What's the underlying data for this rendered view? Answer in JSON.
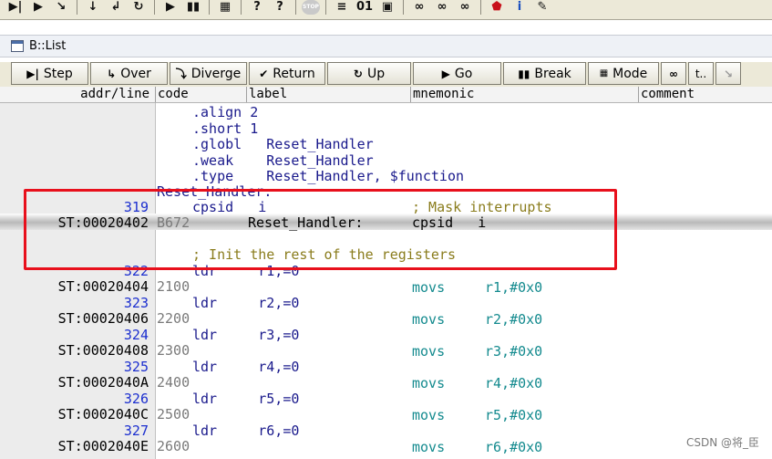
{
  "window": {
    "title": "B::List"
  },
  "toolbar_buttons": [
    {
      "label": "▶|",
      "name": "step-into-icon"
    },
    {
      "label": "▶",
      "name": "step-over-icon"
    },
    {
      "label": "↘",
      "name": "diverge-icon"
    },
    {
      "label": "↓",
      "name": "down-arrow-icon"
    },
    {
      "label": "↲",
      "name": "return-icon"
    },
    {
      "label": "↻",
      "name": "up-icon"
    },
    {
      "label": "▶",
      "name": "go-icon"
    },
    {
      "label": "▮▮",
      "name": "break-icon"
    },
    {
      "label": "▦",
      "name": "mode-icon"
    },
    {
      "label": "?",
      "name": "help-icon"
    },
    {
      "label": "?",
      "name": "context-help-icon"
    },
    {
      "label": "STOP",
      "name": "stop-icon"
    },
    {
      "label": "≡",
      "name": "list-icon"
    },
    {
      "label": "01",
      "name": "memory-icon"
    },
    {
      "label": "▣",
      "name": "chip-icon"
    },
    {
      "label": "∞",
      "name": "watch-icon"
    },
    {
      "label": "∞",
      "name": "watch2-icon"
    },
    {
      "label": "∞",
      "name": "watch3-icon"
    },
    {
      "label": "⬟",
      "name": "shield-icon"
    },
    {
      "label": "i",
      "name": "info-icon"
    },
    {
      "label": "✎",
      "name": "tools-icon"
    }
  ],
  "list_toolbar": {
    "step": "Step",
    "over": "Over",
    "diverge": "Diverge",
    "return": "Return",
    "up": "Up",
    "go": "Go",
    "break": "Break",
    "mode": "Mode",
    "extra1": "",
    "extra2": "t.."
  },
  "columns": {
    "addr_line": "addr/line",
    "code": "code",
    "label": "label",
    "mnemonic": "mnemonic",
    "comment": "comment"
  },
  "directives": [
    {
      "text": ".align 2"
    },
    {
      "text": ".short 1"
    },
    {
      "text": ".globl   Reset_Handler"
    },
    {
      "text": ".weak    Reset_Handler"
    },
    {
      "text": ".type    Reset_Handler, $function"
    }
  ],
  "label_line": "Reset_Handler:",
  "highlight": {
    "line": "319",
    "source": "cpsid   i",
    "comment": "; Mask interrupts",
    "addr": "ST:00020402",
    "code": "B672",
    "label": "Reset_Handler:",
    "mnemonic": "cpsid   i",
    "init_comment": "; Init the rest of the registers"
  },
  "rows": [
    {
      "line": "322",
      "src": "ldr     r1,=0",
      "addr": "ST:00020404",
      "code": "2100",
      "mnemonic": "movs",
      "operands": "r1,#0x0"
    },
    {
      "line": "323",
      "src": "ldr     r2,=0",
      "addr": "ST:00020406",
      "code": "2200",
      "mnemonic": "movs",
      "operands": "r2,#0x0"
    },
    {
      "line": "324",
      "src": "ldr     r3,=0",
      "addr": "ST:00020408",
      "code": "2300",
      "mnemonic": "movs",
      "operands": "r3,#0x0"
    },
    {
      "line": "325",
      "src": "ldr     r4,=0",
      "addr": "ST:0002040A",
      "code": "2400",
      "mnemonic": "movs",
      "operands": "r4,#0x0"
    },
    {
      "line": "326",
      "src": "ldr     r5,=0",
      "addr": "ST:0002040C",
      "code": "2500",
      "mnemonic": "movs",
      "operands": "r5,#0x0"
    },
    {
      "line": "327",
      "src": "ldr     r6,=0",
      "addr": "ST:0002040E",
      "code": "2600",
      "mnemonic": "movs",
      "operands": "r6,#0x0"
    }
  ],
  "watermark": "CSDN @将_臣",
  "colors": {
    "highlight_border": "#e8101c",
    "mnemonic": "#138a8e",
    "line_number": "#1c2fcf",
    "comment": "#8a7c1c"
  }
}
